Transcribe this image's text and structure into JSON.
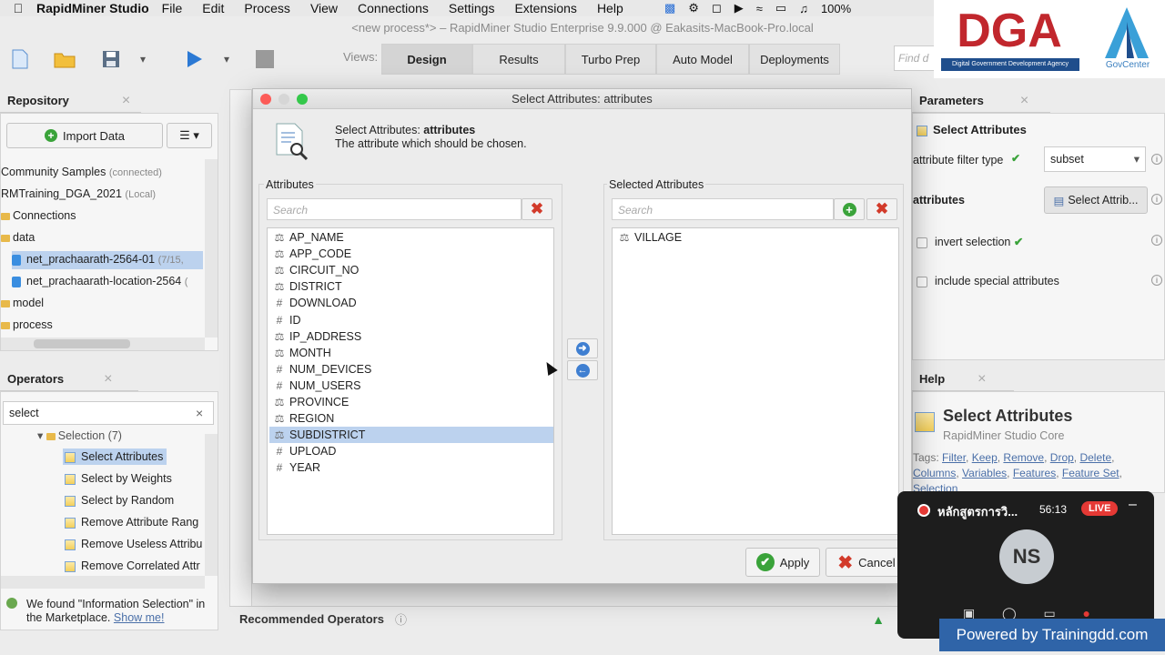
{
  "menubar": {
    "app_name": "RapidMiner Studio",
    "items": [
      "File",
      "Edit",
      "Process",
      "View",
      "Connections",
      "Settings",
      "Extensions",
      "Help"
    ],
    "battery": "100%"
  },
  "window_title": "<new process*> – RapidMiner Studio Enterprise 9.9.000 @ Eakasits-MacBook-Pro.local",
  "toolbar": {
    "views_label": "Views:",
    "views": [
      "Design",
      "Results",
      "Turbo Prep",
      "Auto Model",
      "Deployments"
    ],
    "active_view": "Design",
    "find_placeholder": "Find d"
  },
  "repository": {
    "title": "Repository",
    "import_label": "Import Data",
    "items": [
      {
        "label": "Community Samples",
        "note": "(connected)"
      },
      {
        "label": "RMTraining_DGA_2021",
        "note": "(Local)"
      },
      {
        "label": "Connections",
        "note": ""
      },
      {
        "label": "data",
        "note": ""
      },
      {
        "label": "net_prachaarath-2564-01",
        "note": "(7/15,"
      },
      {
        "label": "net_prachaarath-location-2564",
        "note": "("
      },
      {
        "label": "model",
        "note": ""
      },
      {
        "label": "process",
        "note": ""
      }
    ]
  },
  "operators": {
    "title": "Operators",
    "search_value": "select",
    "group_label": "Selection (7)",
    "items": [
      "Select Attributes",
      "Select by Weights",
      "Select by Random",
      "Remove Attribute Rang",
      "Remove Useless Attribu",
      "Remove Correlated Attr"
    ],
    "marketplace_text": "We found \"Information Selection\" in the Marketplace.",
    "marketplace_link": "Show me!"
  },
  "recommended_label": "Recommended Operators",
  "dialog": {
    "title": "Select Attributes: attributes",
    "header_prefix": "Select Attributes: ",
    "header_bold": "attributes",
    "description": "The attribute which should be chosen.",
    "left_label": "Attributes",
    "right_label": "Selected Attributes",
    "search_placeholder": "Search",
    "attributes": [
      {
        "name": "AP_NAME",
        "type": "nominal"
      },
      {
        "name": "APP_CODE",
        "type": "nominal"
      },
      {
        "name": "CIRCUIT_NO",
        "type": "nominal"
      },
      {
        "name": "DISTRICT",
        "type": "nominal"
      },
      {
        "name": "DOWNLOAD",
        "type": "numeric"
      },
      {
        "name": "ID",
        "type": "numeric"
      },
      {
        "name": "IP_ADDRESS",
        "type": "nominal"
      },
      {
        "name": "MONTH",
        "type": "nominal"
      },
      {
        "name": "NUM_DEVICES",
        "type": "numeric"
      },
      {
        "name": "NUM_USERS",
        "type": "numeric"
      },
      {
        "name": "PROVINCE",
        "type": "nominal"
      },
      {
        "name": "REGION",
        "type": "nominal"
      },
      {
        "name": "SUBDISTRICT",
        "type": "nominal",
        "selected": true
      },
      {
        "name": "UPLOAD",
        "type": "numeric"
      },
      {
        "name": "YEAR",
        "type": "numeric"
      }
    ],
    "selected_attributes": [
      {
        "name": "VILLAGE",
        "type": "nominal"
      }
    ],
    "apply_label": "Apply",
    "cancel_label": "Cancel"
  },
  "parameters": {
    "title": "Parameters",
    "operator_name": "Select Attributes",
    "filter_type_label": "attribute filter type",
    "filter_type_value": "subset",
    "attributes_label": "attributes",
    "select_btn_label": "Select Attrib...",
    "invert_label": "invert selection",
    "include_special_label": "include special attributes"
  },
  "help": {
    "title": "Help",
    "heading": "Select Attributes",
    "subheading": "RapidMiner Studio Core",
    "tags_prefix": "Tags:",
    "tags": [
      "Filter",
      "Keep",
      "Remove",
      "Drop",
      "Delete",
      "Columns",
      "Variables",
      "Features",
      "Feature Set",
      "Selection"
    ]
  },
  "overlay": {
    "meeting_title": "หลักสูตรการวิ...",
    "timer": "56:13",
    "live_label": "LIVE",
    "avatar_initials": "NS",
    "logo_text": "DGA",
    "logo_subtitle": "Digital Government Development Agency",
    "logo2_text": "GovCenter",
    "powered_by": "Powered by Trainingdd.com"
  }
}
